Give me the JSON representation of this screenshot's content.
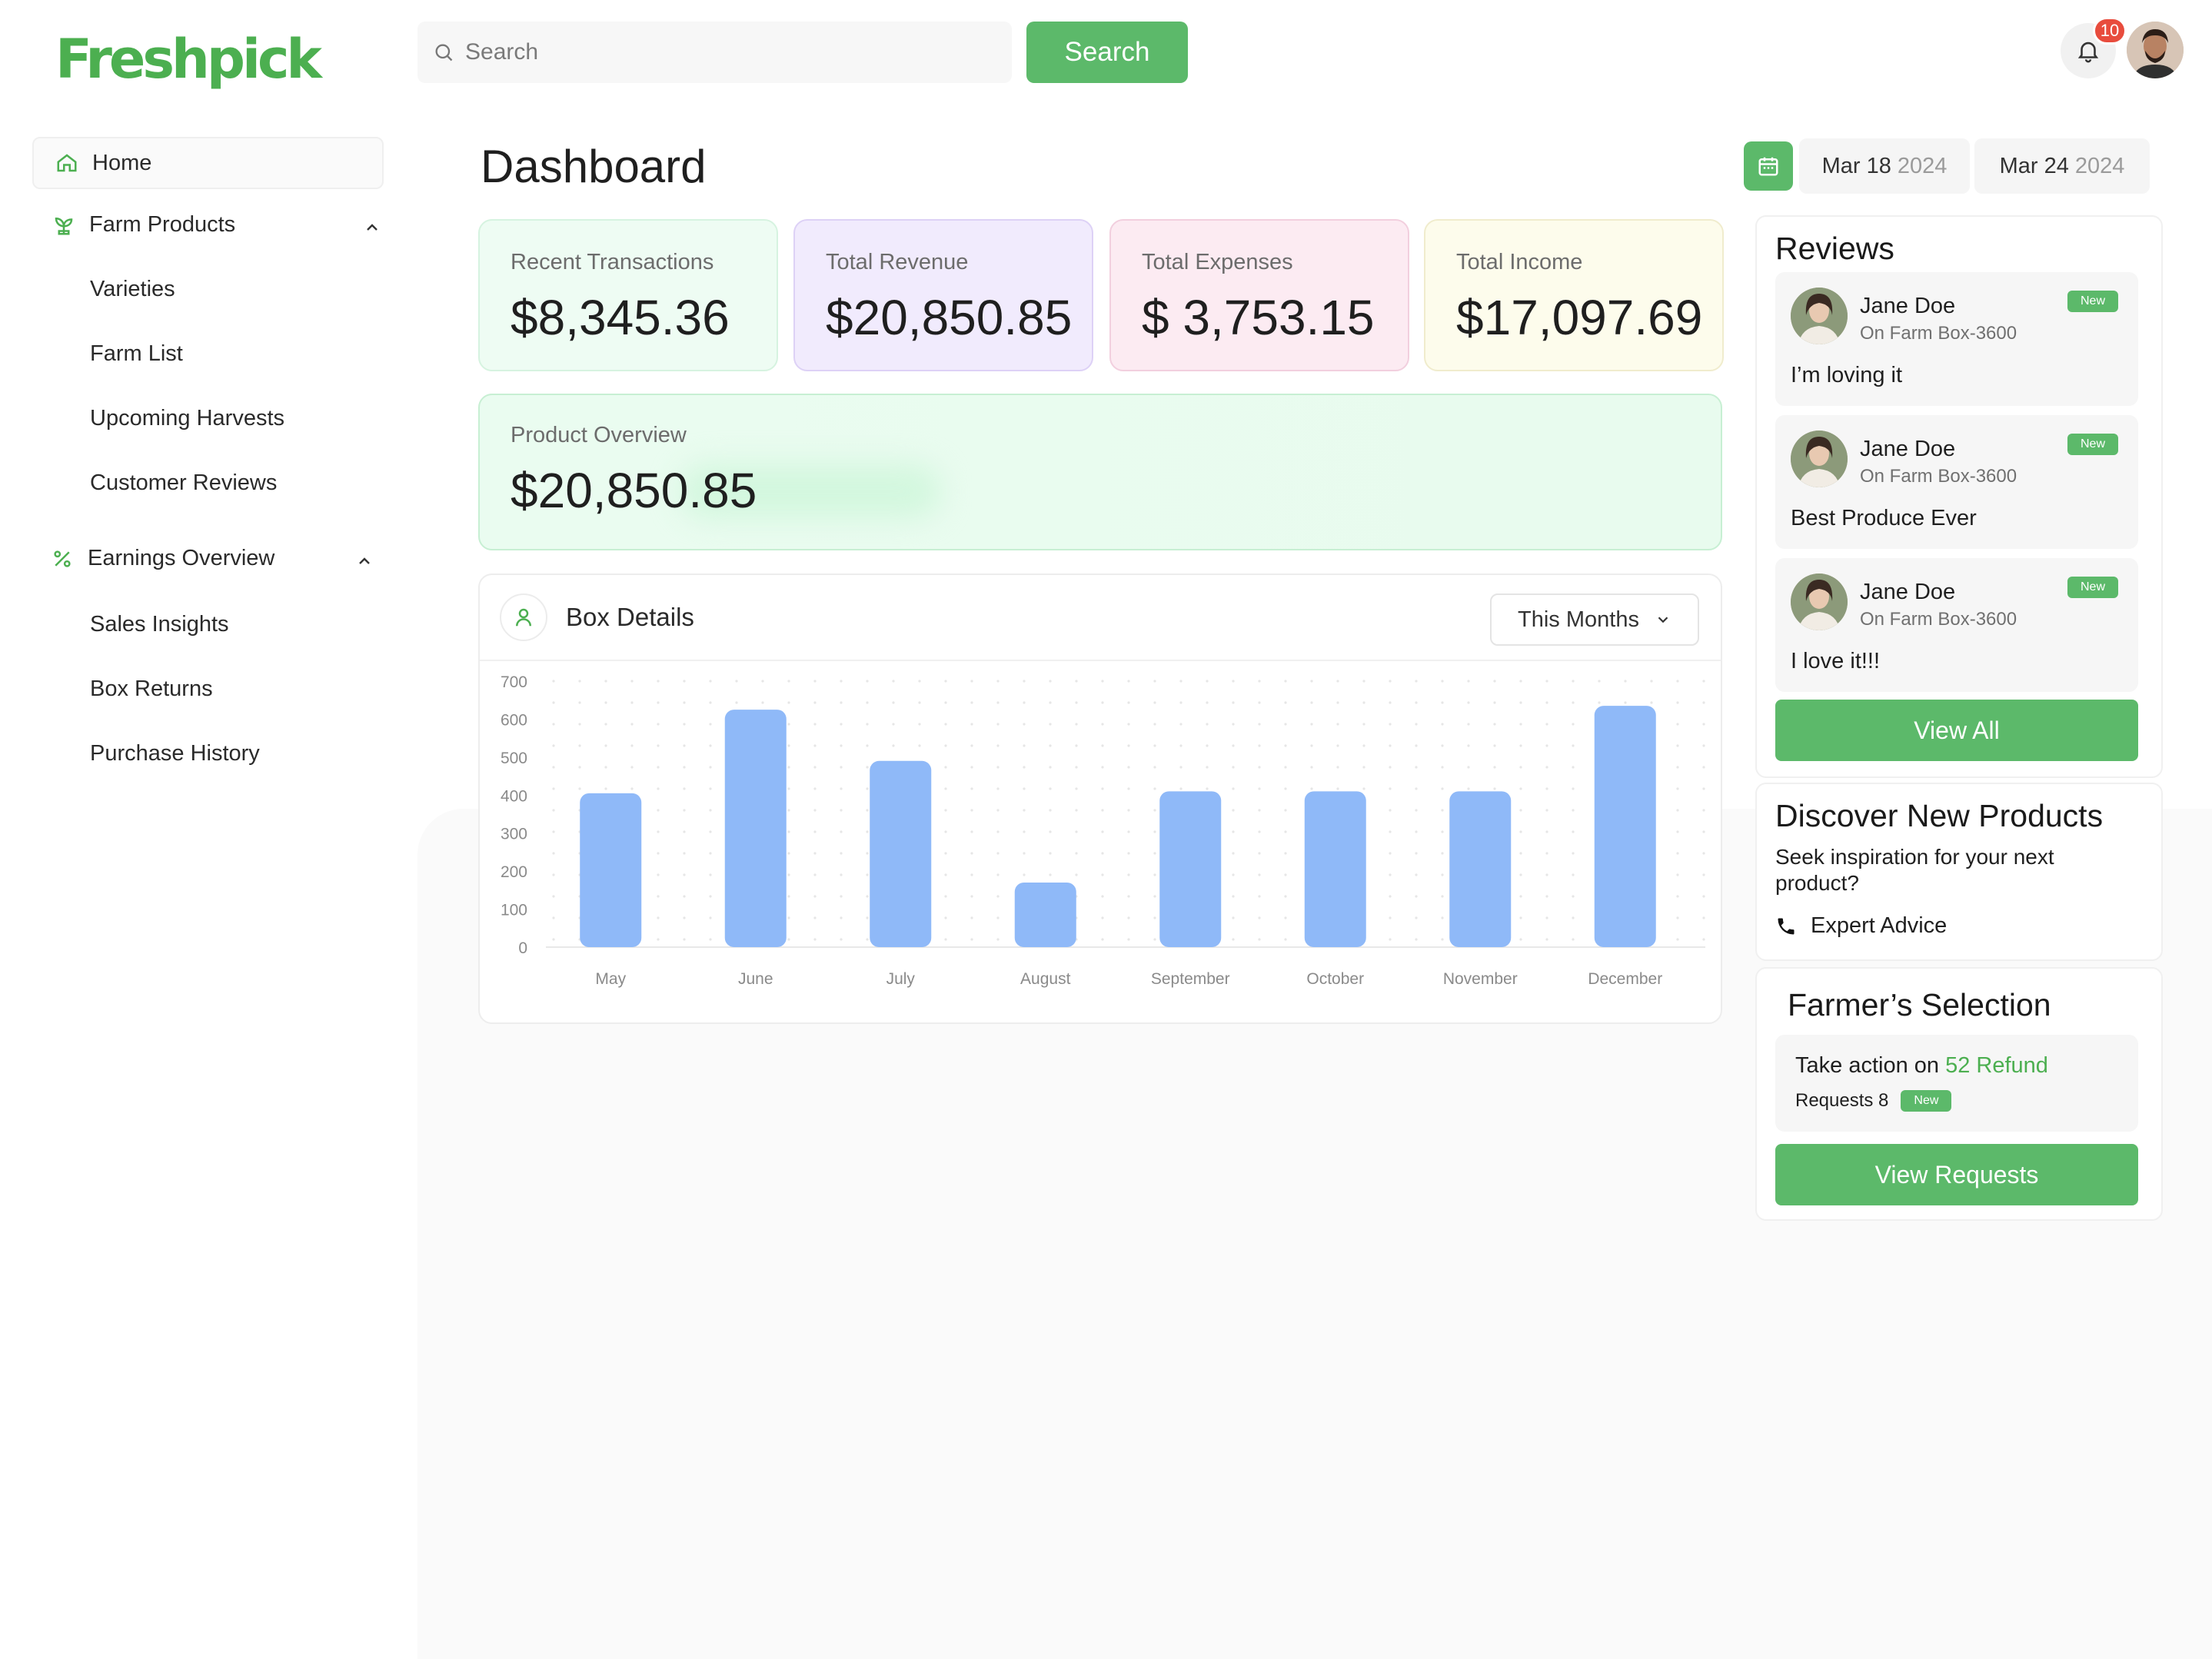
{
  "app": {
    "logo": "Freshpick",
    "accent": "#5cb96a"
  },
  "header": {
    "search_placeholder": "Search",
    "search_button": "Search",
    "notification_count": "10"
  },
  "sidebar": {
    "home": "Home",
    "farm_products": {
      "label": "Farm Products",
      "items": [
        "Varieties",
        "Farm List",
        "Upcoming Harvests",
        "Customer Reviews"
      ]
    },
    "earnings_overview": {
      "label": "Earnings Overview",
      "items": [
        "Sales Insights",
        "Box Returns",
        "Purchase History"
      ]
    }
  },
  "main": {
    "title": "Dashboard",
    "date_range": {
      "from_day": "Mar 18",
      "from_year": "2024",
      "to_day": "Mar 24",
      "to_year": "2024"
    },
    "stats": [
      {
        "label": "Recent Transactions",
        "value": "$8,345.36",
        "color": "#eefcf3"
      },
      {
        "label": "Total Revenue",
        "value": "$20,850.85",
        "color": "#f1ebfd"
      },
      {
        "label": "Total Expenses",
        "value": "$ 3,753.15",
        "color": "#fcebf2"
      },
      {
        "label": "Total Income",
        "value": "$17,097.69",
        "color": "#fdfcec"
      }
    ],
    "overview": {
      "label": "Product Overview",
      "value": "$20,850.85"
    },
    "box_details": {
      "title": "Box Details",
      "period": "This Months"
    }
  },
  "chart_data": {
    "type": "bar",
    "categories": [
      "May",
      "June",
      "July",
      "August",
      "September",
      "October",
      "November",
      "December"
    ],
    "values": [
      405,
      625,
      490,
      170,
      410,
      410,
      410,
      635
    ],
    "ylim": [
      0,
      700
    ],
    "yticks": [
      0,
      100,
      200,
      300,
      400,
      500,
      600,
      700
    ],
    "bar_color": "#8fb9f8",
    "grid": "dotted"
  },
  "reviews": {
    "title": "Reviews",
    "items": [
      {
        "name": "Jane Doe",
        "farm": "On Farm Box-3600",
        "badge": "New",
        "text": "I’m loving it"
      },
      {
        "name": "Jane Doe",
        "farm": "On Farm Box-3600",
        "badge": "New",
        "text": "Best Produce Ever"
      },
      {
        "name": "Jane Doe",
        "farm": "On Farm Box-3600",
        "badge": "New",
        "text": "I love it!!!"
      }
    ],
    "view_all": "View All"
  },
  "discover": {
    "title": "Discover New Products",
    "text": "Seek inspiration for your next product?",
    "link": "Expert Advice"
  },
  "farmer_selection": {
    "title": "Farmer’s Selection",
    "take_prefix": "Take action on",
    "take_highlight": "52 Refund",
    "requests": "Requests 8",
    "badge": "New",
    "button": "View Requests"
  }
}
